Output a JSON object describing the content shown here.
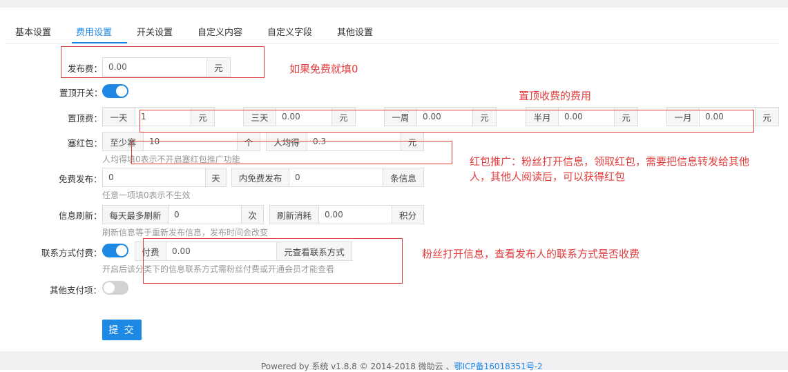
{
  "tabs": [
    "基本设置",
    "费用设置",
    "开关设置",
    "自定义内容",
    "自定义字段",
    "其他设置"
  ],
  "publish_fee": {
    "label": "发布费：",
    "value": "0.00",
    "unit": "元"
  },
  "top_switch": {
    "label": "置顶开关：",
    "state": "on"
  },
  "top_fee": {
    "label": "置顶费：",
    "items": [
      {
        "name": "一天",
        "value": "1",
        "unit": "元"
      },
      {
        "name": "三天",
        "value": "0.00",
        "unit": "元"
      },
      {
        "name": "一周",
        "value": "0.00",
        "unit": "元"
      },
      {
        "name": "半月",
        "value": "0.00",
        "unit": "元"
      },
      {
        "name": "一月",
        "value": "0.00",
        "unit": "元"
      }
    ]
  },
  "red_packet": {
    "label": "塞红包：",
    "min_label": "至少塞",
    "min_value": "10",
    "min_unit": "个",
    "avg_label": "人均得",
    "avg_value": "0.3",
    "avg_unit": "元",
    "hint": "人均得填0表示不开启塞红包推广功能"
  },
  "free_publish": {
    "label": "免费发布：",
    "days_value": "0",
    "days_unit": "天",
    "inner_label": "内免费发布",
    "count_value": "0",
    "count_unit": "条信息",
    "hint": "任意一项填0表示不生效"
  },
  "refresh": {
    "label": "信息刷新：",
    "daily_label": "每天最多刷新",
    "daily_value": "0",
    "daily_unit": "次",
    "cost_label": "刷新消耗",
    "cost_value": "0.00",
    "cost_unit": "积分",
    "hint": "刷新信息等于重新发布信息，发布时间会改变"
  },
  "contact_pay": {
    "label": "联系方式付费：",
    "state": "on",
    "pay_label": "付费",
    "pay_value": "0.00",
    "pay_unit": "元查看联系方式",
    "hint": "开启后该分类下的信息联系方式需粉丝付费或开通会员才能查看"
  },
  "other_pay": {
    "label": "其他支付项：",
    "state": "off"
  },
  "submit_label": "提 交",
  "annotations": {
    "free": "如果免费就填0",
    "top": "置顶收费的费用",
    "red_line1": "红包推广：粉丝打开信息，领取红包，需要把信息转发给其他",
    "red_line2": "人，其他人阅读后，可以获得红包",
    "contact": "粉丝打开信息，查看发布人的联系方式是否收费"
  },
  "footer": {
    "text": "Powered by 系统 v1.8.8 © 2014-2018 微助云 、",
    "icp": "鄂ICP备16018351号-2"
  },
  "colors": {
    "accent": "#1e88e5",
    "annotation": "#e03c3c"
  }
}
